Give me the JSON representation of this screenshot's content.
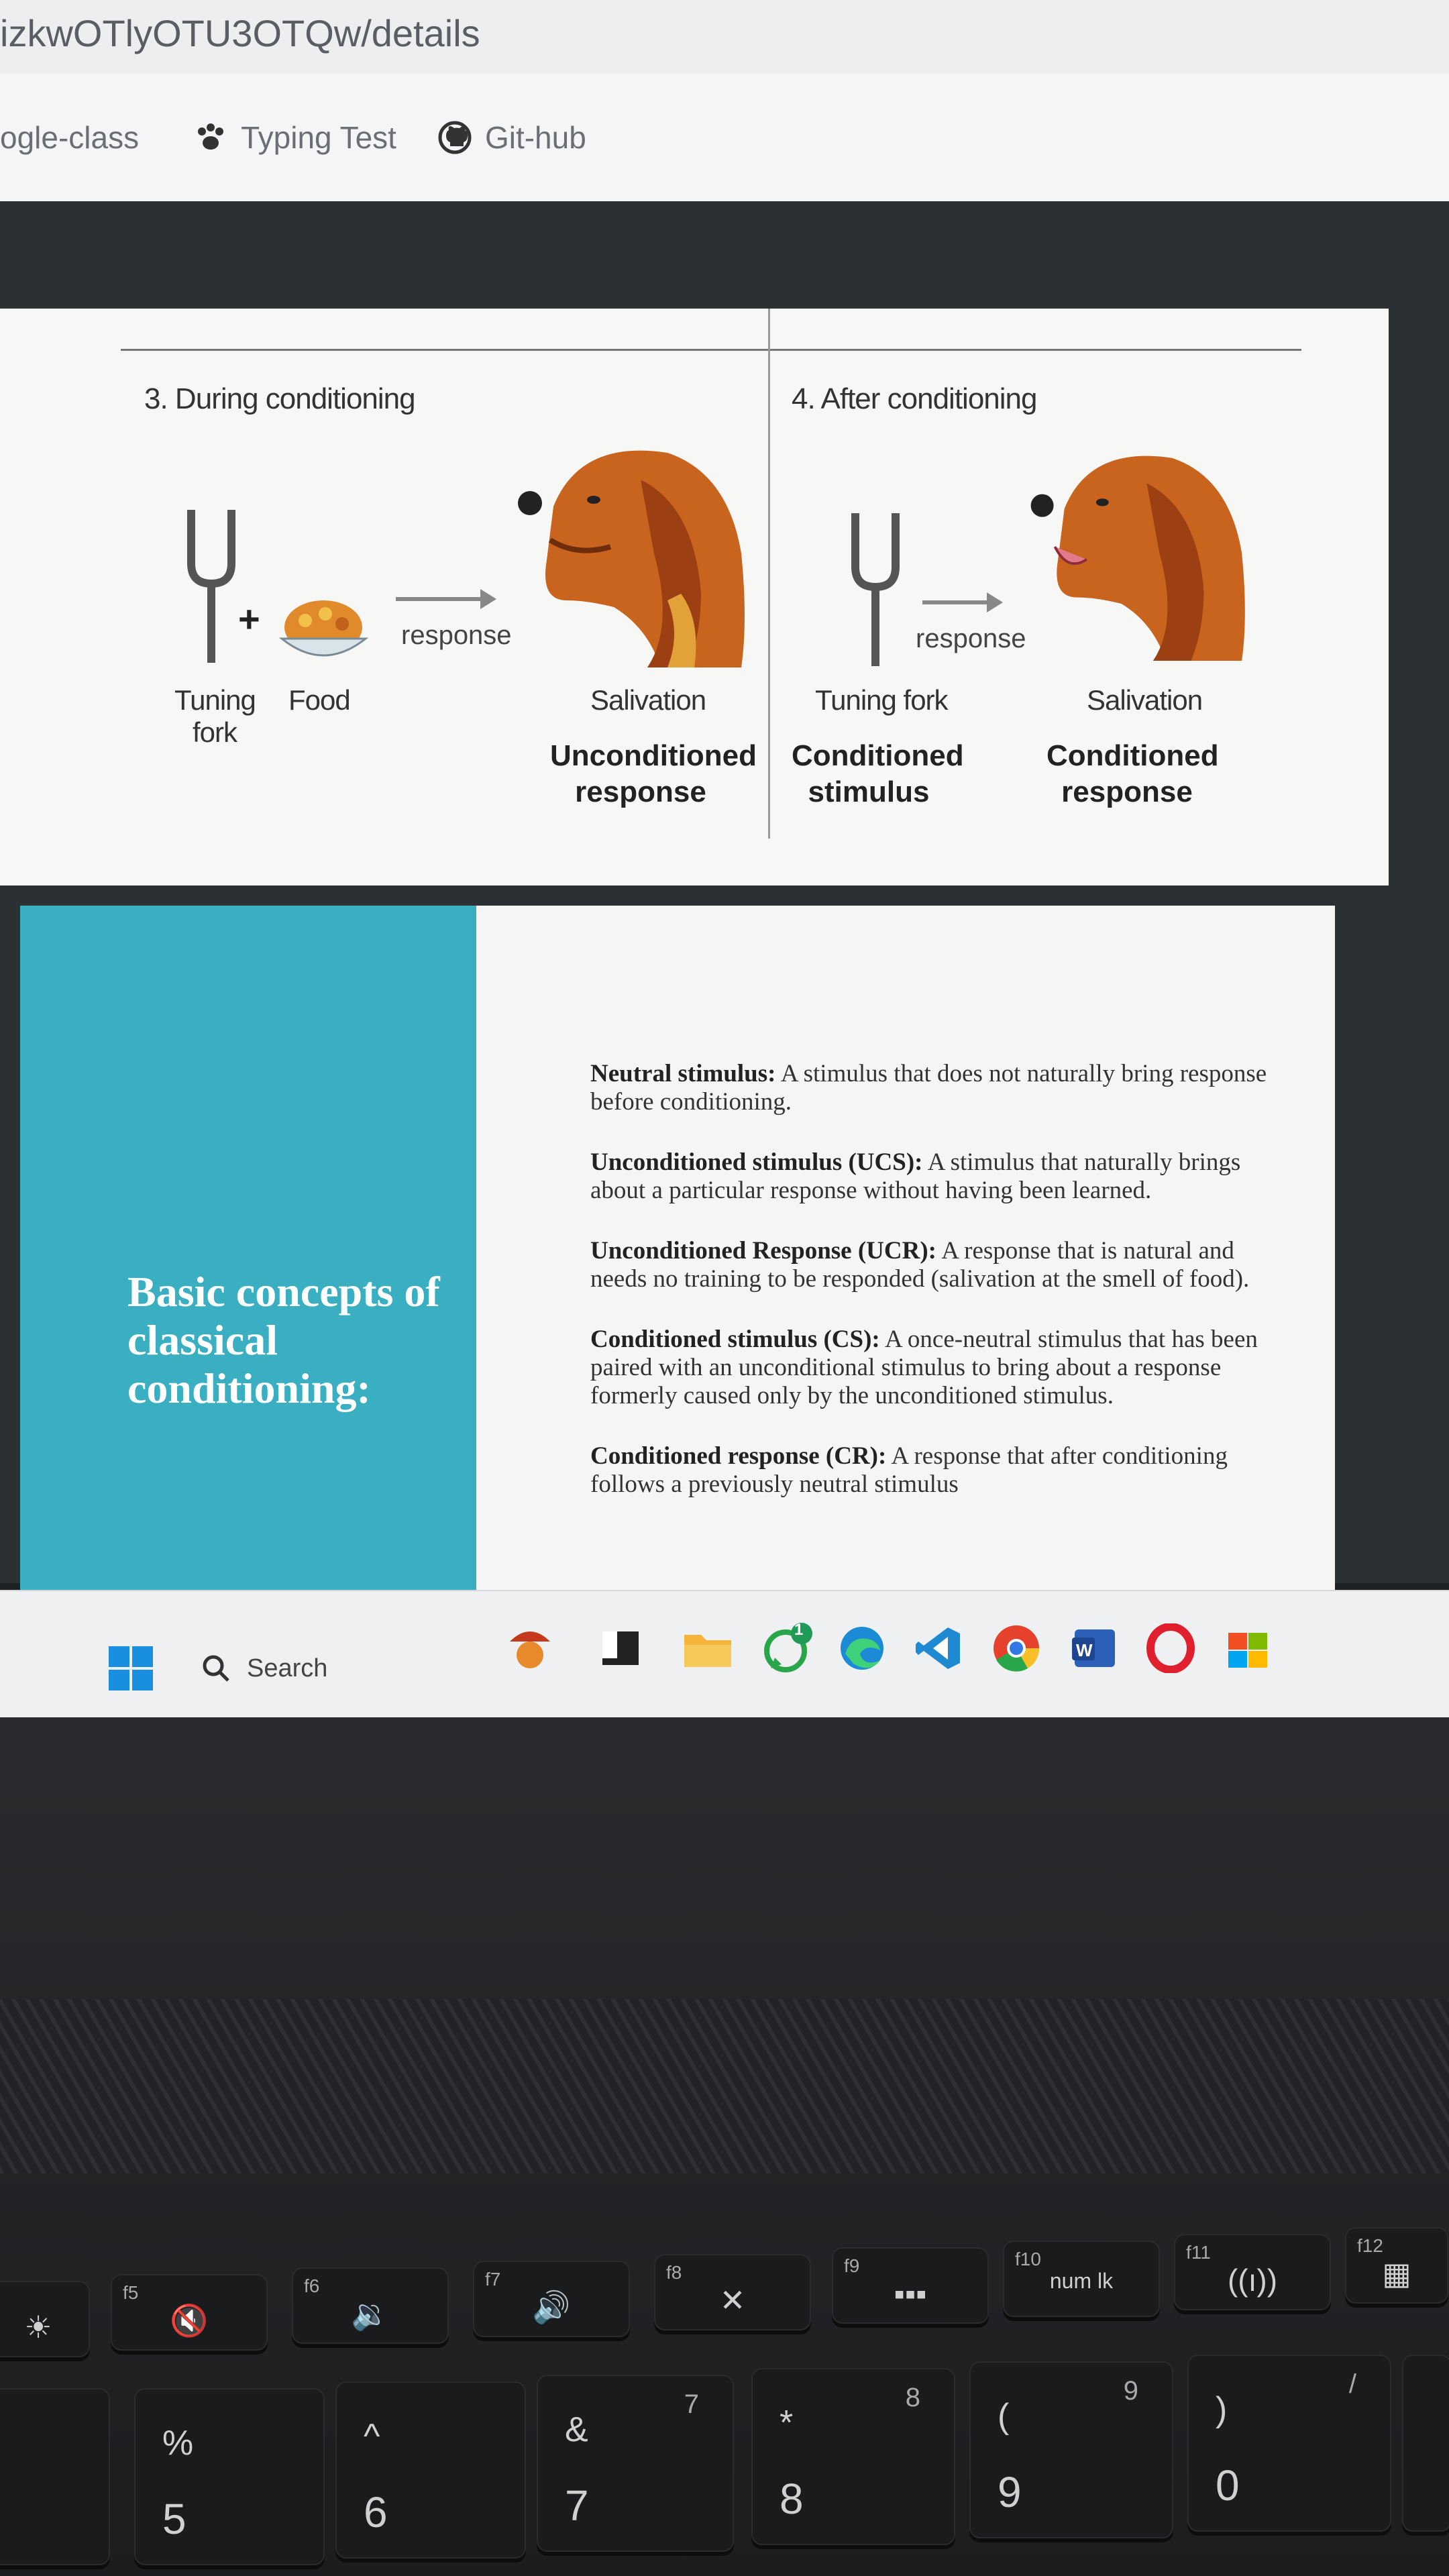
{
  "browser": {
    "url": "izkwOTlyOTU3OTQw/details",
    "bookmarks": [
      {
        "label": "ogle-class",
        "icon": "none"
      },
      {
        "label": "Typing Test",
        "icon": "paw-icon"
      },
      {
        "label": "Git-hub",
        "icon": "github-icon"
      }
    ]
  },
  "slide1": {
    "panel3_title": "3. During conditioning",
    "panel4_title": "4. After conditioning",
    "response_label_left": "response",
    "response_label_right": "response",
    "tuning_fork_label": "Tuning fork",
    "food_label": "Food",
    "salivation_left": "Salivation",
    "unconditioned_response": "Unconditioned response",
    "tuning_fork_right": "Tuning fork",
    "conditioned_stimulus": "Conditioned stimulus",
    "salivation_right": "Salivation",
    "conditioned_response": "Conditioned response"
  },
  "slide2": {
    "title": "Basic concepts of classical conditioning:",
    "definitions": [
      {
        "term": "Neutral stimulus:",
        "text": "A stimulus that does not naturally bring response before conditioning."
      },
      {
        "term": "Unconditioned stimulus (UCS):",
        "text": "A stimulus that naturally brings about a particular response without having been learned."
      },
      {
        "term": "Unconditioned Response (UCR):",
        "text": "A response that is natural and needs no training to be responded (salivation at the smell of food)."
      },
      {
        "term": "Conditioned stimulus (CS):",
        "text": "A once-neutral stimulus that has been paired with an unconditional stimulus to bring about a response formerly caused only by the unconditioned stimulus."
      },
      {
        "term": "Conditioned response (CR):",
        "text": "A response that after conditioning follows a previously neutral stimulus"
      }
    ]
  },
  "taskbar": {
    "search_label": "Search",
    "whatsapp_badge": "1"
  },
  "keyboard": {
    "fn_keys": [
      "f5",
      "f6",
      "f7",
      "f8",
      "f9",
      "f10",
      "f11",
      "f12"
    ],
    "numlock_label": "num lk",
    "number_keys": [
      {
        "top": "%",
        "bottom": "5"
      },
      {
        "top": "^",
        "bottom": "6"
      },
      {
        "top": "&",
        "bottom": "7",
        "side": "7"
      },
      {
        "top": "*",
        "bottom": "8",
        "side": "8"
      },
      {
        "top": "(",
        "bottom": "9",
        "side": "9"
      },
      {
        "top": ")",
        "bottom": "0",
        "side": "/"
      }
    ]
  },
  "colors": {
    "teal": "#3aafc2",
    "slide_bg": "#f7f7f5",
    "dog": "#c8641e"
  }
}
